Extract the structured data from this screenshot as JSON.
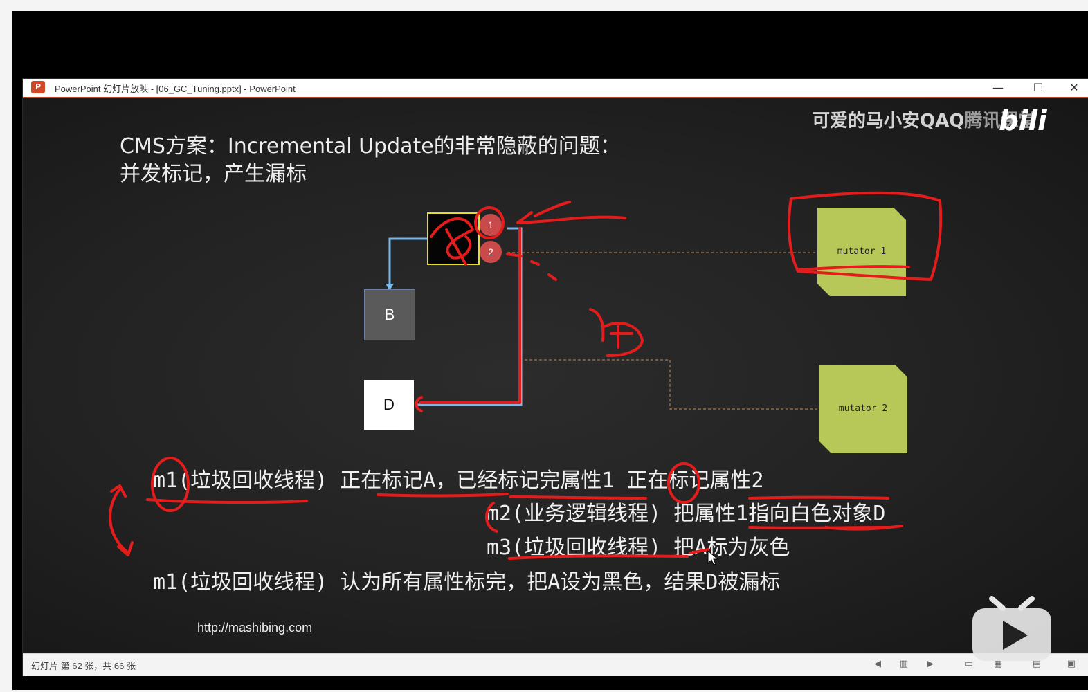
{
  "window": {
    "title": "PowerPoint 幻灯片放映 - [06_GC_Tuning.pptx] - PowerPoint",
    "min_glyph": "—",
    "max_glyph": "☐",
    "close_glyph": "✕",
    "logo_letter": "P"
  },
  "slide": {
    "title_line1": "CMS方案：Incremental Update的非常隐蔽的问题：",
    "title_line2": "并发标记，产生漏标",
    "watermark": "可爱的马小安QAQ",
    "watermark2": "腾讯课堂",
    "bili": "bili",
    "diagram": {
      "box_b": "B",
      "box_d": "D",
      "attr_1": "1",
      "attr_2": "2",
      "mutator_1": "mutator 1",
      "mutator_2": "mutator 2"
    },
    "steps": [
      "m1(垃圾回收线程) 正在标记A，已经标记完属性1  正在标记属性2",
      "m2(业务逻辑线程) 把属性1指向白色对象D",
      "m3(垃圾回收线程) 把A标为灰色",
      "m1(垃圾回收线程) 认为所有属性标完，把A设为黑色，结果D被漏标"
    ],
    "url": "http://mashibing.com"
  },
  "statusbar": {
    "slide_counter": "幻灯片 第 62 张，共 66 张"
  },
  "icons": [
    "powerpoint-logo-icon",
    "minimize-icon",
    "maximize-icon",
    "close-icon",
    "prev-slide-icon",
    "slide-sorter-icon",
    "next-slide-icon",
    "normal-view-icon",
    "grid-view-icon",
    "reading-view-icon",
    "presenter-icon",
    "bilibili-tv-play-icon",
    "mouse-cursor-icon"
  ],
  "colors": {
    "annotation_red": "#e51c1c",
    "mutator_green": "#b8c858",
    "a_box_border": "#e6dc2a",
    "arrow_blue": "#79b8e8"
  }
}
